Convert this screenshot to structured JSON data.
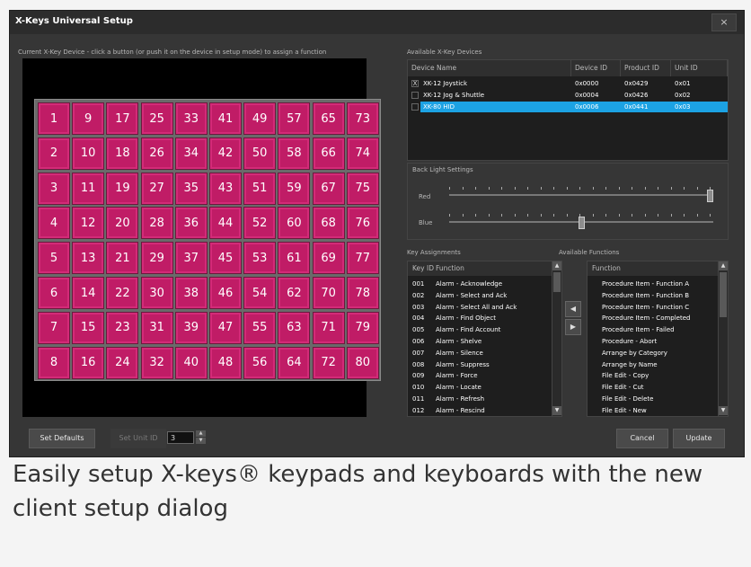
{
  "dialog": {
    "title": "X-Keys Universal Setup",
    "close_label": "×",
    "current_device_label": "Current X-Key Device - click a button  (or push it on the device in setup mode) to assign a function",
    "available_devices_label": "Available X-Key Devices",
    "keys": [
      "1",
      "9",
      "17",
      "25",
      "33",
      "41",
      "49",
      "57",
      "65",
      "73",
      "2",
      "10",
      "18",
      "26",
      "34",
      "42",
      "50",
      "58",
      "66",
      "74",
      "3",
      "11",
      "19",
      "27",
      "35",
      "43",
      "51",
      "59",
      "67",
      "75",
      "4",
      "12",
      "20",
      "28",
      "36",
      "44",
      "52",
      "60",
      "68",
      "76",
      "5",
      "13",
      "21",
      "29",
      "37",
      "45",
      "53",
      "61",
      "69",
      "77",
      "6",
      "14",
      "22",
      "30",
      "38",
      "46",
      "54",
      "62",
      "70",
      "78",
      "7",
      "15",
      "23",
      "31",
      "39",
      "47",
      "55",
      "63",
      "71",
      "79",
      "8",
      "16",
      "24",
      "32",
      "40",
      "48",
      "56",
      "64",
      "72",
      "80"
    ],
    "key_color": "#c01c66"
  },
  "devices_table": {
    "headers": [
      "Device Name",
      "Device ID",
      "Product ID",
      "Unit ID"
    ],
    "rows": [
      {
        "check": "X",
        "name": "XK-12 Joystick",
        "device_id": "0x0000",
        "product_id": "0x0429",
        "unit_id": "0x01"
      },
      {
        "check": "",
        "name": "XK-12 Jog & Shuttle",
        "device_id": "0x0004",
        "product_id": "0x0426",
        "unit_id": "0x02"
      },
      {
        "check": "",
        "name": "XK-80 HID",
        "device_id": "0x0006",
        "product_id": "0x0441",
        "unit_id": "0x03"
      }
    ],
    "selected_color": "#1ca2e3"
  },
  "backlight": {
    "title": "Back Light Settings",
    "red_label": "Red",
    "blue_label": "Blue",
    "red_level": 1.0,
    "blue_level": 0.5
  },
  "key_assignments": {
    "title": "Key Assignments",
    "headers": [
      "Key ID",
      "Function"
    ],
    "rows": [
      {
        "id": "001",
        "fn": "Alarm - Acknowledge"
      },
      {
        "id": "002",
        "fn": "Alarm - Select and Ack"
      },
      {
        "id": "003",
        "fn": "Alarm - Select All and Ack"
      },
      {
        "id": "004",
        "fn": "Alarm - Find Object"
      },
      {
        "id": "005",
        "fn": "Alarm - Find Account"
      },
      {
        "id": "006",
        "fn": "Alarm - Shelve"
      },
      {
        "id": "007",
        "fn": "Alarm - Silence"
      },
      {
        "id": "008",
        "fn": "Alarm - Suppress"
      },
      {
        "id": "009",
        "fn": "Alarm - Force"
      },
      {
        "id": "010",
        "fn": "Alarm - Locate"
      },
      {
        "id": "011",
        "fn": "Alarm - Refresh"
      },
      {
        "id": "012",
        "fn": "Alarm - Rescind"
      }
    ]
  },
  "available_functions": {
    "title": "Available Functions",
    "header": "Function",
    "items": [
      "Procedure Item - Function A",
      "Procedure Item - Function B",
      "Procedure Item - Function C",
      "Procedure Item - Completed",
      "Procedure Item - Failed",
      "Procedure - Abort",
      "Arrange by Category",
      "Arrange by Name",
      "File Edit - Copy",
      "File Edit - Cut",
      "File Edit - Delete",
      "File Edit - New"
    ]
  },
  "footer": {
    "set_defaults": "Set Defaults",
    "set_unit_id": "Set Unit ID",
    "unit_id_value": "3",
    "cancel": "Cancel",
    "update": "Update"
  },
  "caption": "Easily setup X-keys® keypads and keyboards with the new client setup dialog"
}
